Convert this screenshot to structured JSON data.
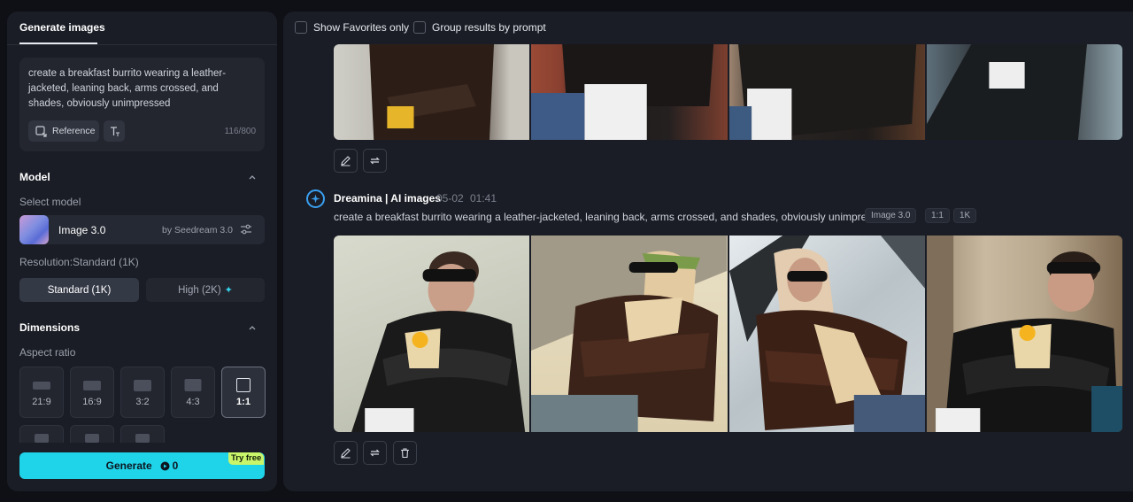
{
  "left_panel": {
    "tab_label": "Generate images",
    "prompt": {
      "text": "create a breakfast burrito wearing a leather-jacketed, leaning back, arms crossed, and shades, obviously unimpressed",
      "reference_label": "Reference",
      "char_count": "116/800"
    },
    "model": {
      "section_title": "Model",
      "select_label": "Select model",
      "name": "Image 3.0",
      "by": "by Seedream 3.0",
      "resolution_label": "Resolution:Standard (1K)",
      "standard_label": "Standard (1K)",
      "high_label": "High (2K)"
    },
    "dimensions": {
      "section_title": "Dimensions",
      "aspect_label": "Aspect ratio",
      "ratios": [
        "21:9",
        "16:9",
        "3:2",
        "4:3",
        "1:1"
      ],
      "selected_ratio": "1:1"
    },
    "generate": {
      "label": "Generate",
      "credits": "0",
      "badge": "Try free"
    }
  },
  "right_panel": {
    "filters": {
      "favorites_label": "Show Favorites only",
      "group_label": "Group results by prompt"
    },
    "generation": {
      "source": "Dreamina | AI images",
      "date": "05-02",
      "time": "01:41",
      "prompt": "create a breakfast burrito wearing a leather-jacketed, leaning back, arms crossed, and shades, obviously unimpressed",
      "tags": [
        "Image 3.0",
        "1:1",
        "1K"
      ]
    }
  },
  "colors": {
    "accent": "#1fd3e8",
    "panel_bg": "#1a1d25",
    "page_bg": "#0e1015",
    "try_free_badge": "#c9f56a"
  },
  "icons": [
    "reference-icon",
    "text-style-icon",
    "chevron-up-icon",
    "settings-sliders-icon",
    "sparkle-icon",
    "credit-icon",
    "edit-icon",
    "regenerate-icon",
    "delete-icon",
    "dreamina-logo-icon"
  ]
}
